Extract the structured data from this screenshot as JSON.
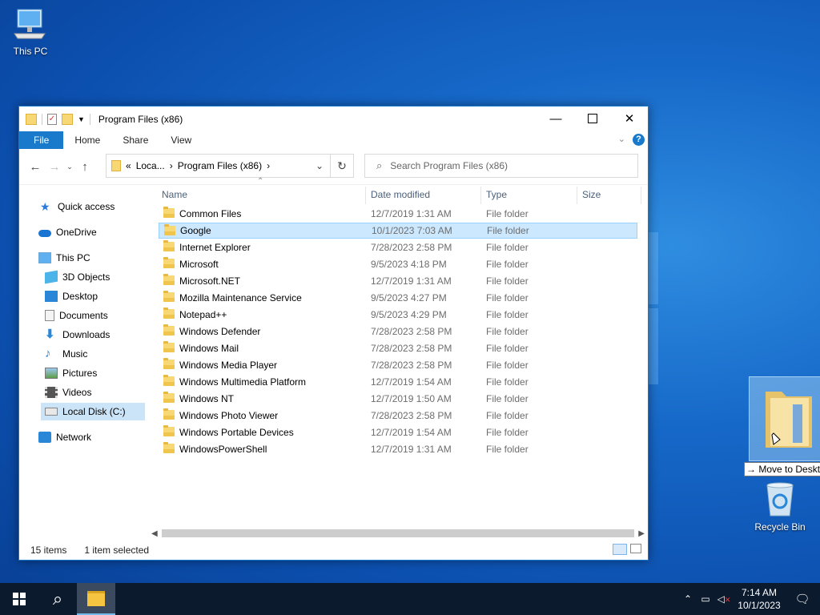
{
  "desktop": {
    "this_pc_label": "This PC",
    "recycle_bin_label": "Recycle Bin"
  },
  "window": {
    "title": "Program Files (x86)",
    "ribbon_tabs": [
      "File",
      "Home",
      "Share",
      "View"
    ],
    "address": {
      "prefix": "«",
      "segment1": "Loca...",
      "segment2": "Program Files (x86)"
    },
    "search_placeholder": "Search Program Files (x86)",
    "nav": {
      "quick_access": "Quick access",
      "onedrive": "OneDrive",
      "this_pc": "This PC",
      "objects3d": "3D Objects",
      "desktop": "Desktop",
      "documents": "Documents",
      "downloads": "Downloads",
      "music": "Music",
      "pictures": "Pictures",
      "videos": "Videos",
      "local_disk": "Local Disk (C:)",
      "network": "Network"
    },
    "columns": {
      "name": "Name",
      "date": "Date modified",
      "type": "Type",
      "size": "Size"
    },
    "files": [
      {
        "name": "Common Files",
        "date": "12/7/2019 1:31 AM",
        "type": "File folder"
      },
      {
        "name": "Google",
        "date": "10/1/2023 7:03 AM",
        "type": "File folder"
      },
      {
        "name": "Internet Explorer",
        "date": "7/28/2023 2:58 PM",
        "type": "File folder"
      },
      {
        "name": "Microsoft",
        "date": "9/5/2023 4:18 PM",
        "type": "File folder"
      },
      {
        "name": "Microsoft.NET",
        "date": "12/7/2019 1:31 AM",
        "type": "File folder"
      },
      {
        "name": "Mozilla Maintenance Service",
        "date": "9/5/2023 4:27 PM",
        "type": "File folder"
      },
      {
        "name": "Notepad++",
        "date": "9/5/2023 4:29 PM",
        "type": "File folder"
      },
      {
        "name": "Windows Defender",
        "date": "7/28/2023 2:58 PM",
        "type": "File folder"
      },
      {
        "name": "Windows Mail",
        "date": "7/28/2023 2:58 PM",
        "type": "File folder"
      },
      {
        "name": "Windows Media Player",
        "date": "7/28/2023 2:58 PM",
        "type": "File folder"
      },
      {
        "name": "Windows Multimedia Platform",
        "date": "12/7/2019 1:54 AM",
        "type": "File folder"
      },
      {
        "name": "Windows NT",
        "date": "12/7/2019 1:50 AM",
        "type": "File folder"
      },
      {
        "name": "Windows Photo Viewer",
        "date": "7/28/2023 2:58 PM",
        "type": "File folder"
      },
      {
        "name": "Windows Portable Devices",
        "date": "12/7/2019 1:54 AM",
        "type": "File folder"
      },
      {
        "name": "WindowsPowerShell",
        "date": "12/7/2019 1:31 AM",
        "type": "File folder"
      }
    ],
    "status": {
      "count": "15 items",
      "selected": "1 item selected"
    }
  },
  "drag_tooltip": "→ Move to Desktop",
  "taskbar": {
    "time": "7:14 AM",
    "date": "10/1/2023"
  }
}
